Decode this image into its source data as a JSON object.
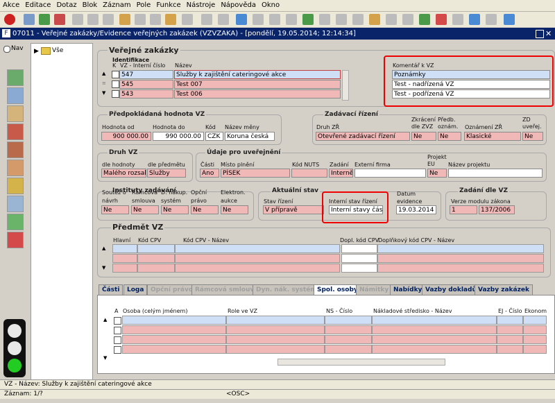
{
  "menu": [
    "Akce",
    "Editace",
    "Dotaz",
    "Blok",
    "Záznam",
    "Pole",
    "Funkce",
    "Nástroje",
    "Nápověda",
    "Okno"
  ],
  "window_title": "07011 - Veřejné zakázky/Evidence veřejných zakázek (VZVZAKA) - [pondělí, 19.05.2014; 12:14:34]",
  "nav": {
    "radio_label": "Nav",
    "tree_root": "Vše"
  },
  "main": {
    "section_title": "Veřejné zakázky",
    "identifikace": {
      "header": "Identifikace",
      "col_k": "K",
      "col_id": "VZ - Interní číslo",
      "col_name": "Název",
      "rows": [
        {
          "id": "547",
          "name": "Služby k zajištění cateringové akce"
        },
        {
          "id": "545",
          "name": "Test 007"
        },
        {
          "id": "543",
          "name": "Test 006"
        }
      ],
      "komentar_label": "Komentář k VZ",
      "komentar_rows": [
        "Poznámky",
        "Test - nadřízená VZ",
        "Test - podřízená VZ"
      ]
    },
    "predpokladana": {
      "title": "Předpokládaná hodnota VZ",
      "od_label": "Hodnota od",
      "do_label": "Hodnota do",
      "kod_label": "Kód",
      "mena_label": "Název měny",
      "od": "900 000.00",
      "do": "990 000.00",
      "kod": "CZK",
      "mena": "Koruna česká"
    },
    "zadavaci": {
      "title": "Zadávací řízení",
      "druh_label": "Druh ZŘ",
      "zkraceni_label": "Zkrácení dle ZVZ",
      "predb_label": "Předb. oznám.",
      "oznameni_label": "Oznámení ZŘ",
      "zd_label": "ZD uveřej.",
      "druh": "Otevřené zadávací řízení",
      "zkraceni": "Ne",
      "predb": "Ne",
      "oznameni": "Klasické",
      "zd": "Ne"
    },
    "druh_vz": {
      "title": "Druh VZ",
      "hodnota_label": "dle hodnoty",
      "predmet_label": "dle předmětu",
      "hodnota": "Malého rozsahu",
      "predmet": "Služby"
    },
    "udaje": {
      "title": "Údaje pro uveřejnění",
      "casti_label": "Části",
      "misto_label": "Místo plnění",
      "nuts_label": "Kód NUTS",
      "zadani_label": "Zadání",
      "firma_label": "Externí firma",
      "projekt_label": "Projekt EU",
      "nazev_label": "Název projektu",
      "casti": "Ano",
      "misto": "PÍSEK",
      "nuts": "",
      "zadani": "Interně",
      "firma": "",
      "projekt": "Ne",
      "nazev": ""
    },
    "instituty": {
      "title": "Instituty zadávání",
      "labels": [
        "Soutěž o návrh",
        "Rámcová smlouva",
        "D. nákup. systém",
        "Opční právo",
        "Elektron. aukce"
      ],
      "values": [
        "Ne",
        "Ne",
        "Ne",
        "Ne",
        "Ne"
      ]
    },
    "aktualni": {
      "title": "Aktuální stav",
      "stav_label": "Stav řízení",
      "interni_label": "Interní stav řízení",
      "datum_label": "Datum evidence",
      "stav": "V přípravě",
      "interni": "Interní stavy částí",
      "datum": "19.03.2014"
    },
    "zadani_dle": {
      "title": "Zadání dle VZ",
      "label": "Verze modulu zákona",
      "verze": "1",
      "zakon": "137/2006"
    },
    "predmet": {
      "title": "Předmět VZ",
      "cols": [
        "Hlavní",
        "Kód CPV",
        "Kód CPV - Název",
        "Dopl. kód CPV",
        "Doplňkový kód CPV - Název"
      ]
    },
    "tabs": [
      {
        "label": "Části",
        "state": "on"
      },
      {
        "label": "Loga",
        "state": "on"
      },
      {
        "label": "Opční právo",
        "state": "dis"
      },
      {
        "label": "Rámcová smlouva",
        "state": "dis"
      },
      {
        "label": "Dyn. nák. systém",
        "state": "dis"
      },
      {
        "label": "Spol. osoby",
        "state": "act"
      },
      {
        "label": "Námitky",
        "state": "dis"
      },
      {
        "label": "Nabídky",
        "state": "on"
      },
      {
        "label": "Vazby dokladů",
        "state": "on"
      },
      {
        "label": "Vazby zakázek",
        "state": "on"
      }
    ],
    "osoby": {
      "cols": [
        "A",
        "Osoba (celým jménem)",
        "Role ve VZ",
        "NS - Číslo",
        "Nákladové středisko - Název",
        "EJ - Číslo",
        "Ekonom"
      ]
    }
  },
  "status": {
    "line1": "VZ - Název: Služby k zajištění cateringové akce",
    "zaznam": "Záznam: 1/?",
    "osc": "<OSC>"
  },
  "colors": {
    "title_bar": "#0a246a",
    "required": "#f1b8b8",
    "highlight": "#e00000"
  }
}
